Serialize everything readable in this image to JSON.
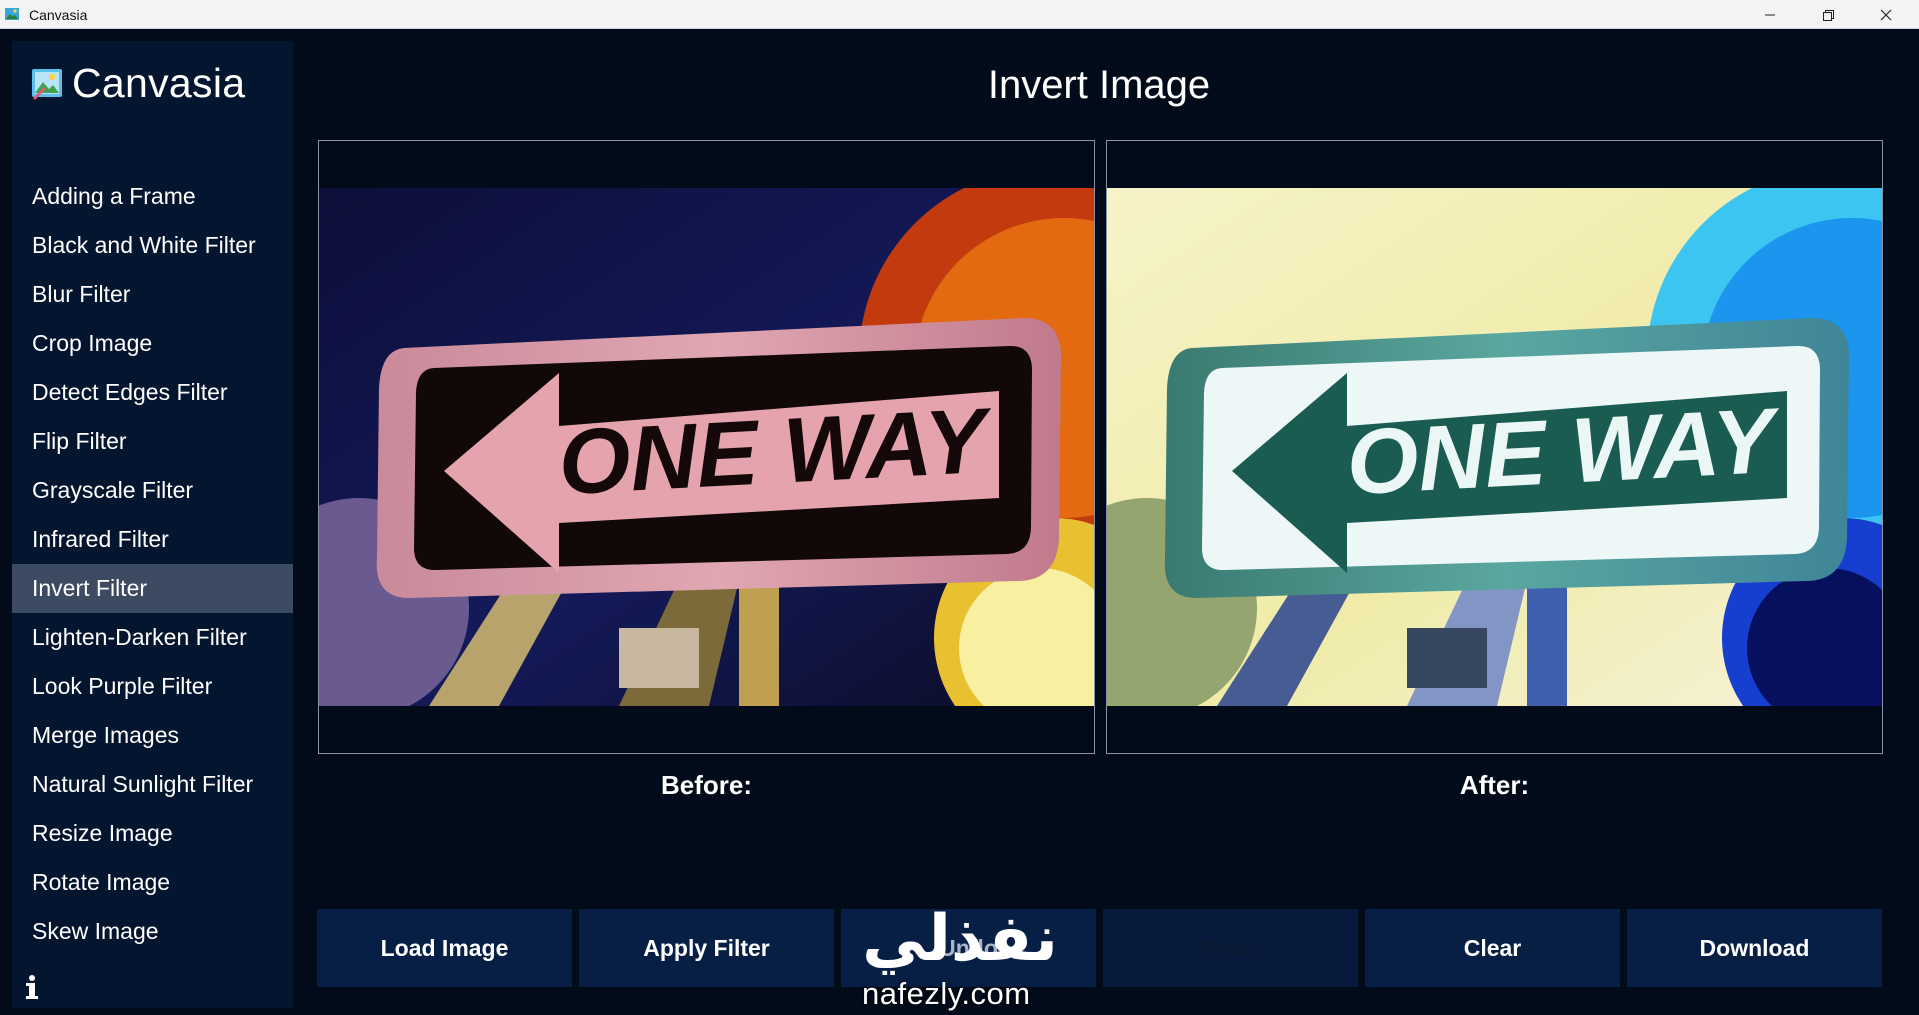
{
  "window": {
    "title": "Canvasia",
    "controls": {
      "minimize": "minimize-icon",
      "maximize": "restore-icon",
      "close": "close-icon"
    }
  },
  "sidebar": {
    "brand": "Canvasia",
    "items": [
      {
        "label": "Adding a Frame"
      },
      {
        "label": "Black and White Filter"
      },
      {
        "label": "Blur Filter"
      },
      {
        "label": "Crop Image"
      },
      {
        "label": "Detect Edges Filter"
      },
      {
        "label": "Flip Filter"
      },
      {
        "label": "Grayscale Filter"
      },
      {
        "label": "Infrared Filter"
      },
      {
        "label": "Invert Filter",
        "active": true
      },
      {
        "label": "Lighten-Darken Filter"
      },
      {
        "label": "Look Purple Filter"
      },
      {
        "label": "Merge Images"
      },
      {
        "label": "Natural Sunlight Filter"
      },
      {
        "label": "Resize Image"
      },
      {
        "label": "Rotate Image"
      },
      {
        "label": "Skew Image"
      }
    ],
    "info_icon": "info-icon"
  },
  "main": {
    "title": "Invert Image",
    "before": {
      "caption": "Before:",
      "sign_text": "ONE WAY"
    },
    "after": {
      "caption": "After:",
      "sign_text": "ONE WAY"
    }
  },
  "toolbar": {
    "load": "Load Image",
    "apply": "Apply Filter",
    "undo": "Undo",
    "redo": "Redo",
    "clear": "Clear",
    "download": "Download"
  },
  "watermark": {
    "arabic": "نفذلي",
    "url": "nafezly.com"
  },
  "colors": {
    "background": "#020b19",
    "sidebar": "#04152f",
    "active_item": "#3c4a62",
    "button": "#071f45"
  }
}
